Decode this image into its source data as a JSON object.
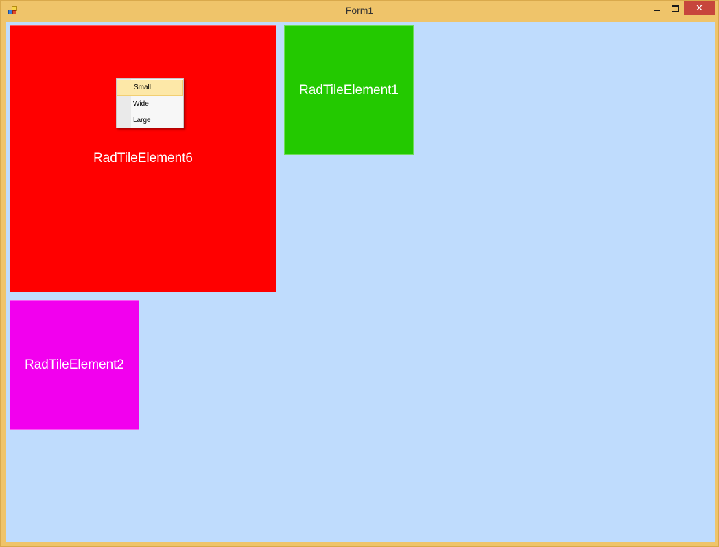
{
  "window": {
    "title": "Form1",
    "close_glyph": "✕"
  },
  "tiles": [
    {
      "label": "RadTileElement6",
      "color": "#ff0000"
    },
    {
      "label": "RadTileElement1",
      "color": "#23c900"
    },
    {
      "label": "RadTileElement2",
      "color": "#f200ee"
    }
  ],
  "context_menu": {
    "items": [
      {
        "label": "Small",
        "highlighted": true
      },
      {
        "label": "Wide",
        "highlighted": false
      },
      {
        "label": "Large",
        "highlighted": false
      }
    ]
  },
  "colors": {
    "frame": "#efc46a",
    "client_background": "#bfdcfd",
    "close_button": "#c7463c",
    "menu_highlight": "#fde8a8"
  },
  "icons": [
    "app-icon",
    "minimize-icon",
    "maximize-icon",
    "close-icon"
  ]
}
